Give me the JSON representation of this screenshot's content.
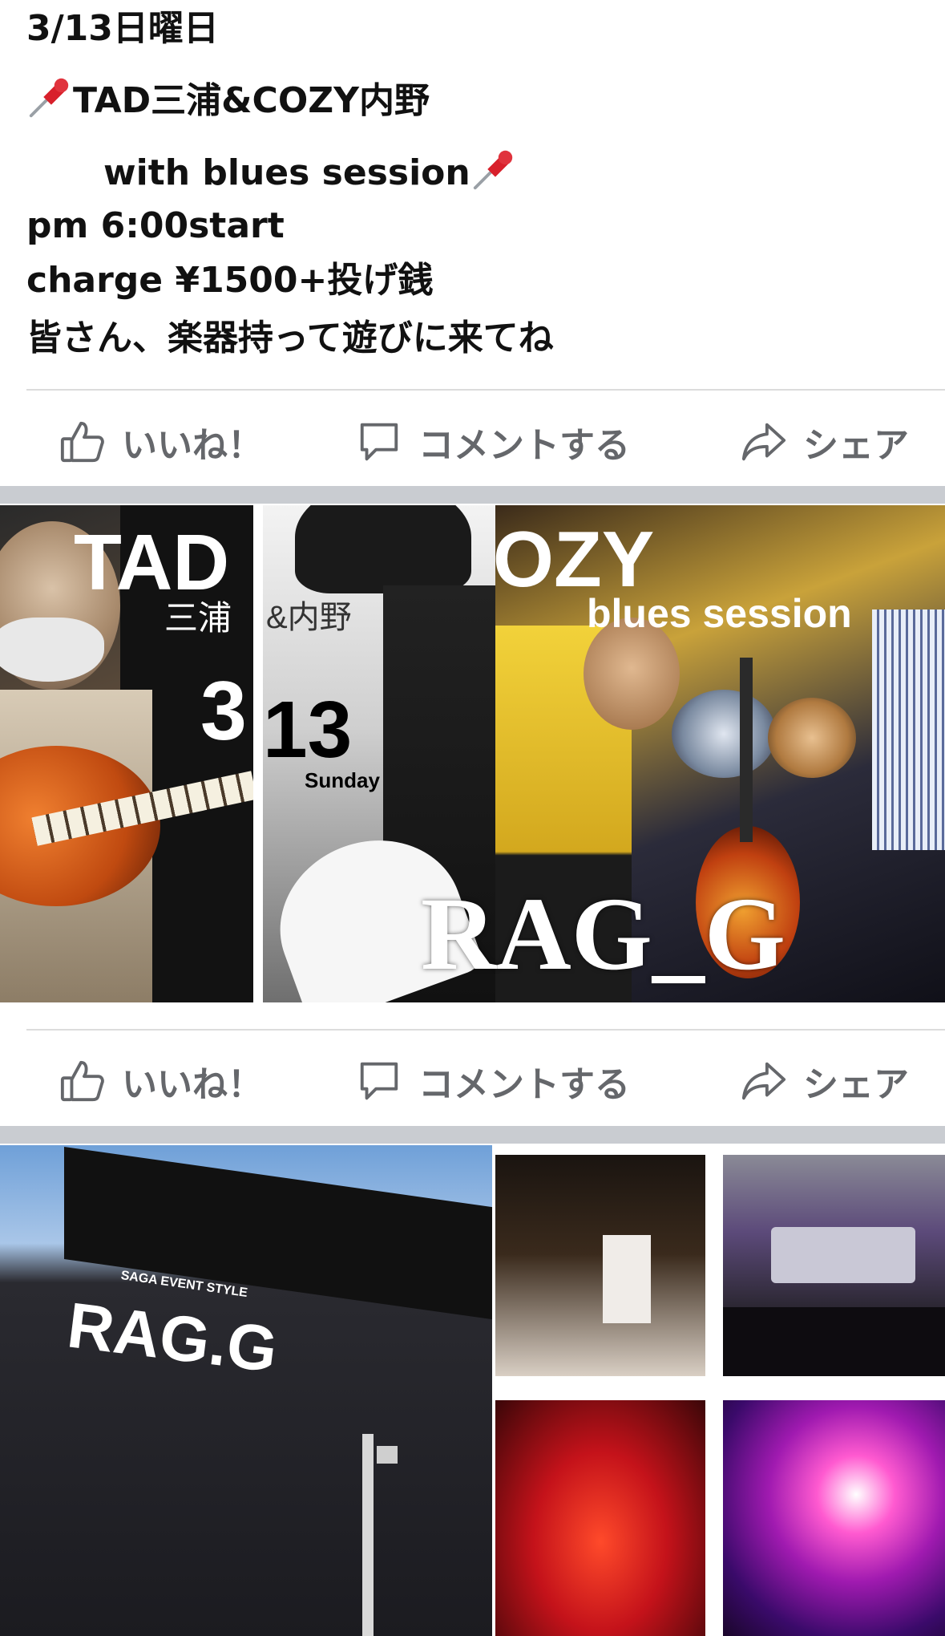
{
  "post": {
    "lines": [
      "3/13日曜日",
      "TAD三浦&COZY内野",
      "with blues session",
      "pm 6:00start",
      "charge ¥1500+投げ銭",
      "皆さん、楽器持って遊びに来てね"
    ]
  },
  "actions": {
    "like": "いいね！",
    "comment": "コメントする",
    "share": "シェア"
  },
  "flyer": {
    "tad": "TAD",
    "miura": "三浦",
    "amp_uchino": "&内野",
    "cozy": "COZY",
    "blues_session": "blues session",
    "day_3": "3",
    "day_13": "13",
    "weekday": "Sunday",
    "venue": "RAG_G"
  },
  "gallery": {
    "building_sign": "RAG.G",
    "building_subsign": "SAGA EVENT STYLE"
  },
  "colors": {
    "action_text": "#65676b",
    "divider": "#dcdcdc",
    "section_gap": "#c9ccd1",
    "pin_red": "#d8202b"
  }
}
